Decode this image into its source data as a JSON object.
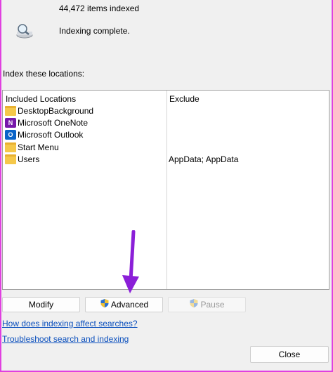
{
  "status": {
    "items_indexed": "44,472 items indexed",
    "message": "Indexing complete."
  },
  "locations": {
    "section_label": "Index these locations:",
    "columns": {
      "included": "Included Locations",
      "exclude": "Exclude"
    },
    "rows": [
      {
        "icon": "folder-icon",
        "name": "DesktopBackground",
        "exclude": ""
      },
      {
        "icon": "onenote-icon",
        "name": "Microsoft OneNote",
        "exclude": ""
      },
      {
        "icon": "outlook-icon",
        "name": "Microsoft Outlook",
        "exclude": ""
      },
      {
        "icon": "folder-icon",
        "name": "Start Menu",
        "exclude": ""
      },
      {
        "icon": "folder-icon",
        "name": "Users",
        "exclude": "AppData; AppData"
      }
    ]
  },
  "buttons": {
    "modify": "Modify",
    "advanced": "Advanced",
    "pause": "Pause",
    "close": "Close"
  },
  "links": {
    "how_affects": "How does indexing affect searches?",
    "troubleshoot": "Troubleshoot search and indexing"
  },
  "colors": {
    "annotation_arrow": "#8b1fd8",
    "link": "#0a4fbd",
    "folder": "#f5c84a"
  }
}
